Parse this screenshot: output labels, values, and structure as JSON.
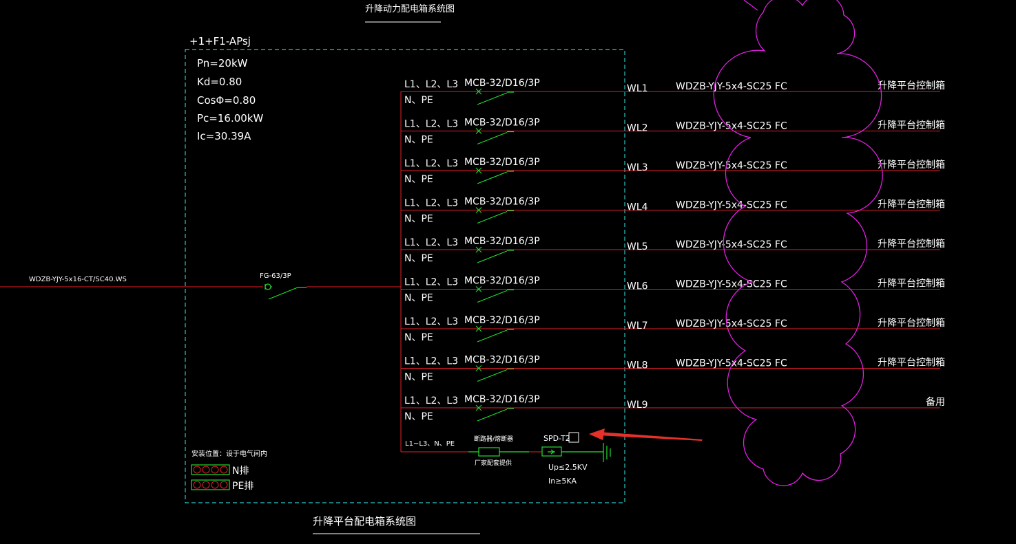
{
  "top_title": "升降动力配电箱系统图",
  "box_id": "+1+F1-APsj",
  "params": [
    "Pn=20kW",
    "Kd=0.80",
    "CosΦ=0.80",
    "Pc=16.00kW",
    "Ic=30.39A"
  ],
  "incoming": {
    "cable": "WDZB-YJY-5x16-CT/SC40.WS",
    "breaker": "FG-63/3P"
  },
  "circuits": [
    {
      "phase": "L1、L2、L3",
      "np": "N、PE",
      "breaker": "MCB-32/D16/3P",
      "id": "WL1",
      "cable": "WDZB-YJY-5x4-SC25 FC",
      "dest": "升降平台控制箱"
    },
    {
      "phase": "L1、L2、L3",
      "np": "N、PE",
      "breaker": "MCB-32/D16/3P",
      "id": "WL2",
      "cable": "WDZB-YJY-5x4-SC25 FC",
      "dest": "升降平台控制箱"
    },
    {
      "phase": "L1、L2、L3",
      "np": "N、PE",
      "breaker": "MCB-32/D16/3P",
      "id": "WL3",
      "cable": "WDZB-YJY-5x4-SC25 FC",
      "dest": "升降平台控制箱"
    },
    {
      "phase": "L1、L2、L3",
      "np": "N、PE",
      "breaker": "MCB-32/D16/3P",
      "id": "WL4",
      "cable": "WDZB-YJY-5x4-SC25 FC",
      "dest": "升降平台控制箱"
    },
    {
      "phase": "L1、L2、L3",
      "np": "N、PE",
      "breaker": "MCB-32/D16/3P",
      "id": "WL5",
      "cable": "WDZB-YJY-5x4-SC25 FC",
      "dest": "升降平台控制箱"
    },
    {
      "phase": "L1、L2、L3",
      "np": "N、PE",
      "breaker": "MCB-32/D16/3P",
      "id": "WL6",
      "cable": "WDZB-YJY-5x4-SC25 FC",
      "dest": "升降平台控制箱"
    },
    {
      "phase": "L1、L2、L3",
      "np": "N、PE",
      "breaker": "MCB-32/D16/3P",
      "id": "WL7",
      "cable": "WDZB-YJY-5x4-SC25 FC",
      "dest": "升降平台控制箱"
    },
    {
      "phase": "L1、L2、L3",
      "np": "N、PE",
      "breaker": "MCB-32/D16/3P",
      "id": "WL8",
      "cable": "WDZB-YJY-5x4-SC25 FC",
      "dest": "升降平台控制箱"
    },
    {
      "phase": "L1、L2、L3",
      "np": "N、PE",
      "breaker": "MCB-32/D16/3P",
      "id": "WL9",
      "cable": "",
      "dest": "备用"
    }
  ],
  "spd": {
    "line": "L1~L3、N、PE",
    "fuse_top": "断路器/熔断器",
    "fuse_bottom": "厂家配套提供",
    "label": "SPD-T2",
    "up": "Up≤2.5KV",
    "in": "In≥5KA"
  },
  "install_note": "安装位置：设于电气间内",
  "bars": {
    "n": "N排",
    "pe": "PE排"
  },
  "bottom_title": "升降平台配电箱系统图",
  "colors": {
    "wire": "#e8202a",
    "symbol": "#22e030",
    "box": "#2bc6c6",
    "cloud": "#e020e0",
    "arrow": "#e8302a",
    "text": "#ffffff"
  }
}
